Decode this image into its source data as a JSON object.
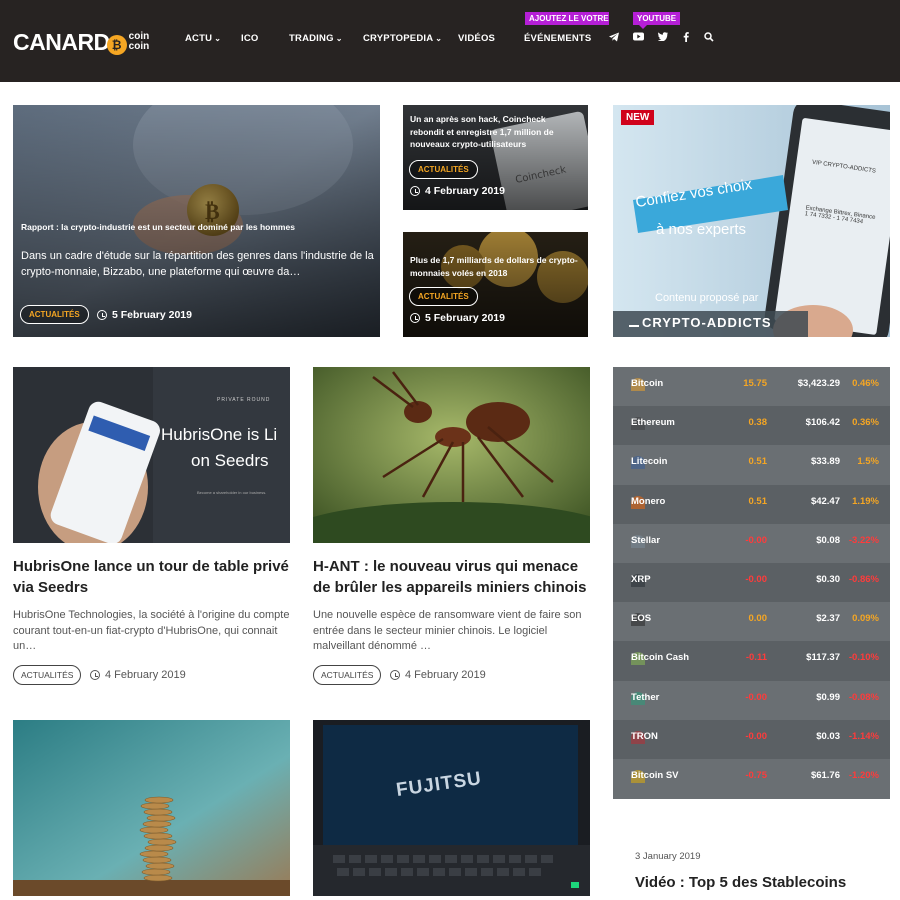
{
  "header": {
    "logo": {
      "main": "CANARD",
      "sub1": "coin",
      "sub2": "coin"
    },
    "nav": [
      {
        "label": "ACTU",
        "dropdown": true
      },
      {
        "label": "ICO",
        "dropdown": false
      },
      {
        "label": "TRADING",
        "dropdown": true
      },
      {
        "label": "CRYPTOPEDIA",
        "dropdown": true
      },
      {
        "label": "VIDÉOS",
        "dropdown": false
      },
      {
        "label": "ÉVÉNEMENTS",
        "dropdown": false
      }
    ],
    "popup_event": "AJOUTEZ LE VOTRE",
    "popup_youtube": "YOUTUBE",
    "social": [
      "telegram-icon",
      "youtube-icon",
      "twitter-icon",
      "facebook-icon",
      "search-icon"
    ],
    "colors": {
      "bar": "#272322",
      "accent": "#b51fd6",
      "gold": "#f5a623"
    }
  },
  "hero": {
    "main": {
      "title": "Rapport : la crypto-industrie est un secteur dominé par les hommes",
      "excerpt": "Dans un cadre d'étude sur la répartition des genres dans l'industrie de la crypto-monnaie, Bizzabo, une plateforme qui œuvre da…",
      "category": "ACTUALITÉS",
      "date": "5 February 2019"
    },
    "side1": {
      "title": "Un an après son hack, Coincheck rebondit et enregistre 1,7 million de nouveaux crypto-utilisateurs",
      "category": "ACTUALITÉS",
      "date": "4 February 2019"
    },
    "side2": {
      "title": "Plus de 1,7 milliards de dollars de crypto-monnaies volés en 2018",
      "category": "ACTUALITÉS",
      "date": "5 February 2019"
    },
    "ad": {
      "badge": "NEW",
      "line1": "Confiez vos choix",
      "line2": "à nos experts",
      "line3": "Contenu proposé par",
      "brand": "CRYPTO-ADDICTS",
      "phone_header": "VIP CRYPTO-ADDICTS",
      "phone_price1": "1 74 7332 - 1 74 7434",
      "phone_line": "Exchange Bittrex, Binance"
    }
  },
  "cards": [
    {
      "image_text1": "PRIVATE ROUND",
      "image_text2": "HubrisOne is Li",
      "image_text3": "on Seedrs",
      "image_text4": "Become a shareholder in our business.",
      "title": "HubrisOne lance un tour de table privé via Seedrs",
      "excerpt": "HubrisOne Technologies, la société à l'origine du compte courant tout-en-un fiat-crypto d'HubrisOne, qui connait un…",
      "category": "ACTUALITÉS",
      "date": "4 February 2019"
    },
    {
      "title": "H-ANT : le nouveau virus qui menace de brûler les appareils miniers chinois",
      "excerpt": "Une nouvelle espèce de ransomware vient de faire son entrée dans le secteur minier chinois. Le logiciel malveillant dénommé …",
      "category": "ACTUALITÉS",
      "date": "4 February 2019"
    }
  ],
  "bottom_cards": [
    {
      "image": "coin-stack"
    },
    {
      "image_text": "FUJITSU"
    }
  ],
  "video": {
    "date": "3 January 2019",
    "title": "Vidéo : Top 5 des Stablecoins"
  },
  "ticker": [
    {
      "name": "Bitcoin",
      "change": "15.75",
      "price": "$3,423.29",
      "pct": "0.46%",
      "dir": "up",
      "icon_color": "#f5a623"
    },
    {
      "name": "Ethereum",
      "change": "0.38",
      "price": "$106.42",
      "pct": "0.36%",
      "dir": "up",
      "icon_color": "#3c3c3d"
    },
    {
      "name": "Litecoin",
      "change": "0.51",
      "price": "$33.89",
      "pct": "1.5%",
      "dir": "up",
      "icon_color": "#345d9d"
    },
    {
      "name": "Monero",
      "change": "0.51",
      "price": "$42.47",
      "pct": "1.19%",
      "dir": "up",
      "icon_color": "#ff6600"
    },
    {
      "name": "Stellar",
      "change": "-0.00",
      "price": "$0.08",
      "pct": "-3.22%",
      "dir": "down",
      "icon_color": "#7a8b99"
    },
    {
      "name": "XRP",
      "change": "-0.00",
      "price": "$0.30",
      "pct": "-0.86%",
      "dir": "down",
      "icon_color": "#23292f"
    },
    {
      "name": "EOS",
      "change": "0.00",
      "price": "$2.37",
      "pct": "0.09%",
      "dir": "up",
      "icon_color": "#222222"
    },
    {
      "name": "Bitcoin Cash",
      "change": "-0.11",
      "price": "$117.37",
      "pct": "-0.10%",
      "dir": "down",
      "icon_color": "#8dc351"
    },
    {
      "name": "Tether",
      "change": "-0.00",
      "price": "$0.99",
      "pct": "-0.08%",
      "dir": "down",
      "icon_color": "#26a17b"
    },
    {
      "name": "TRON",
      "change": "-0.00",
      "price": "$0.03",
      "pct": "-1.14%",
      "dir": "down",
      "icon_color": "#c4262e"
    },
    {
      "name": "Bitcoin SV",
      "change": "-0.75",
      "price": "$61.76",
      "pct": "-1.20%",
      "dir": "down",
      "icon_color": "#eab300"
    }
  ]
}
